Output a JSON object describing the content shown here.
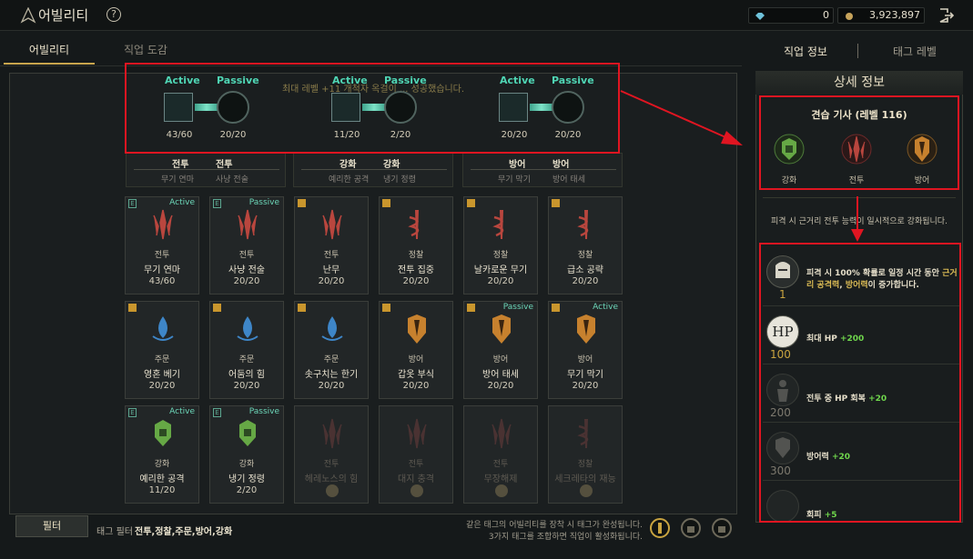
{
  "header": {
    "title": "어빌리티",
    "help": "?",
    "currency1": "0",
    "currency2": "3,923,897"
  },
  "tabs": {
    "ability": "어빌리티",
    "class_book": "직업 도감",
    "class_info": "직업 정보",
    "tag_level": "태그 레벨"
  },
  "banner": "최대 레벨 +11 개척자 옥걸이 ... 성공했습니다.",
  "slots": [
    {
      "left": {
        "label": "Active",
        "count": "43/60"
      },
      "right": {
        "label": "Passive",
        "count": "20/20"
      },
      "tags": [
        "전투",
        "전투"
      ],
      "subs": [
        "무기 연마",
        "사냥 전술"
      ]
    },
    {
      "left": {
        "label": "Active",
        "count": "11/20"
      },
      "right": {
        "label": "Passive",
        "count": "2/20"
      },
      "tags": [
        "강화",
        "강화"
      ],
      "subs": [
        "예리한 공격",
        "냉기 정령"
      ]
    },
    {
      "left": {
        "label": "Active",
        "count": "20/20"
      },
      "right": {
        "label": "Passive",
        "count": "20/20"
      },
      "tags": [
        "방어",
        "방어"
      ],
      "subs": [
        "무기 막기",
        "방어 태세"
      ]
    }
  ],
  "cards": [
    {
      "tag": "전투",
      "name": "무기 연마",
      "level": "43/60",
      "badge": "Active",
      "mark": "E"
    },
    {
      "tag": "전투",
      "name": "사냥 전술",
      "level": "20/20",
      "badge": "Passive",
      "mark": "E"
    },
    {
      "tag": "전투",
      "name": "난무",
      "level": "20/20",
      "badge": "",
      "mark": "up"
    },
    {
      "tag": "정찰",
      "name": "전투 집중",
      "level": "20/20",
      "badge": "",
      "mark": "up"
    },
    {
      "tag": "정찰",
      "name": "날카로운 무기",
      "level": "20/20",
      "badge": "",
      "mark": "up"
    },
    {
      "tag": "정찰",
      "name": "급소 공략",
      "level": "20/20",
      "badge": "",
      "mark": "up"
    },
    {
      "tag": "주문",
      "name": "영혼 베기",
      "level": "20/20",
      "badge": "",
      "mark": "up"
    },
    {
      "tag": "주문",
      "name": "어둠의 힘",
      "level": "20/20",
      "badge": "",
      "mark": "up"
    },
    {
      "tag": "주문",
      "name": "솟구치는 한기",
      "level": "20/20",
      "badge": "",
      "mark": "up"
    },
    {
      "tag": "방어",
      "name": "갑옷 부식",
      "level": "20/20",
      "badge": "",
      "mark": "up"
    },
    {
      "tag": "방어",
      "name": "방어 태세",
      "level": "20/20",
      "badge": "Passive",
      "mark": "up"
    },
    {
      "tag": "방어",
      "name": "무기 막기",
      "level": "20/20",
      "badge": "Active",
      "mark": "up"
    },
    {
      "tag": "강화",
      "name": "예리한 공격",
      "level": "11/20",
      "badge": "Active",
      "mark": "E"
    },
    {
      "tag": "강화",
      "name": "냉기 정령",
      "level": "2/20",
      "badge": "Passive",
      "mark": "E"
    },
    {
      "tag": "전투",
      "name": "헤레노스의 힘",
      "level": "",
      "badge": "",
      "mark": "",
      "locked": true
    },
    {
      "tag": "전투",
      "name": "대지 충격",
      "level": "",
      "badge": "",
      "mark": "",
      "locked": true
    },
    {
      "tag": "전투",
      "name": "무장해제",
      "level": "",
      "badge": "",
      "mark": "",
      "locked": true
    },
    {
      "tag": "정찰",
      "name": "세크레타의 재능",
      "level": "",
      "badge": "",
      "mark": "",
      "locked": true
    }
  ],
  "footer": {
    "filter": "필터",
    "tag_filter_label": "태그 필터",
    "tag_filter_value": "전투,정찰,주문,방어,강화",
    "note1": "같은 태그의 어빌리티를 장착 시 태그가 완성됩니다.",
    "note2": "3가지 태그를 조합하면 직업이 활성화됩니다."
  },
  "detail": {
    "heading": "상세 정보",
    "class_name": "견습 기사 (레벨 116)",
    "icons": [
      "강화",
      "전투",
      "방어"
    ],
    "desc": "피격 시 근거리 전투 능력이 일시적으로 강화됩니다.",
    "effects": [
      {
        "num": "1",
        "text_a": "피격 시 100% 확률로 일정 시간 동안 ",
        "text_b": "근거리 공격력",
        "text_c": ", ",
        "text_d": "방어력",
        "text_e": "이 증가합니다."
      },
      {
        "num": "100",
        "text": "최대 HP",
        "bonus": "+200",
        "icon": "HP"
      },
      {
        "num": "200",
        "text": "전투 중 HP 회복",
        "bonus": "+20"
      },
      {
        "num": "300",
        "text": "방어력",
        "bonus": "+20"
      },
      {
        "num": "",
        "text": "회피",
        "bonus": "+5"
      }
    ]
  },
  "colors": {
    "red_box": "#e01521",
    "accent": "#c9a64d",
    "active": "#4fd5b4"
  }
}
